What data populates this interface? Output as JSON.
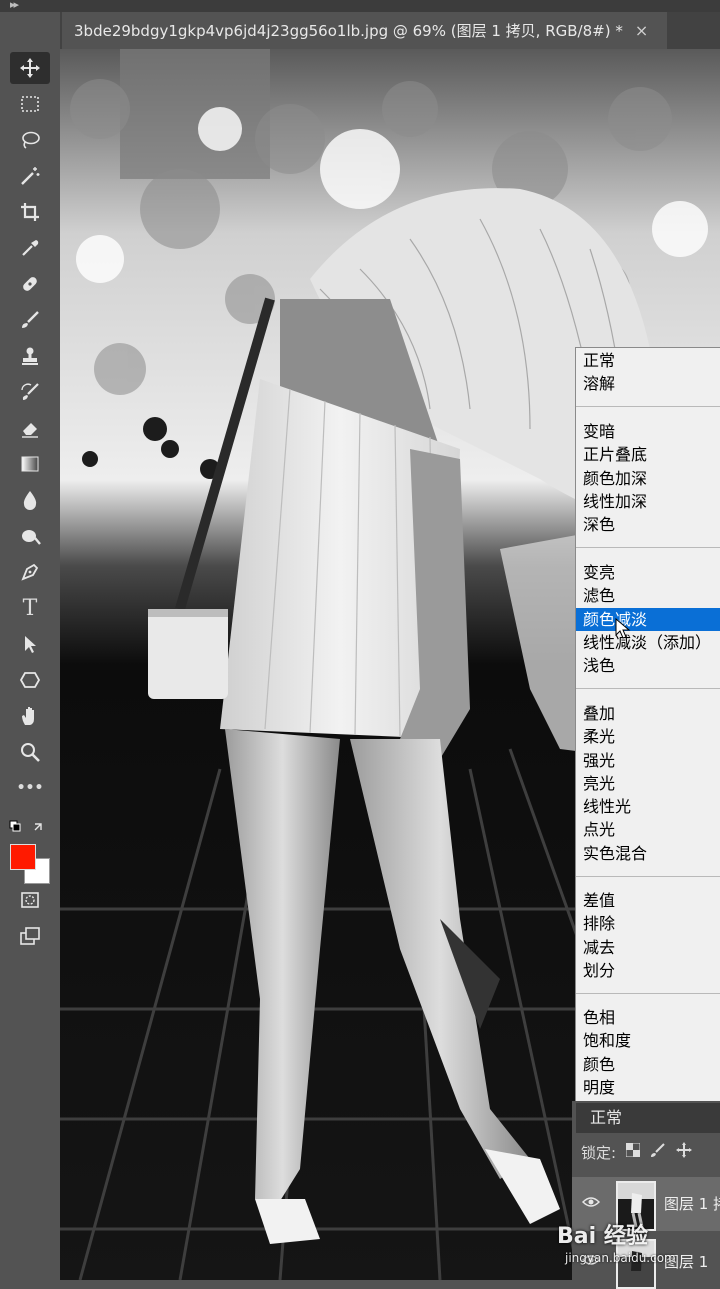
{
  "document": {
    "tab_title": "3bde29bdgy1gkp4vp6jd4j23gg56o1lb.jpg @ 69% (图层 1 拷贝, RGB/8#) *",
    "tab_close": "×"
  },
  "toolbar": {
    "collapse_glyph": "▸▸",
    "tools": [
      {
        "name": "move-tool-icon",
        "active": true
      },
      {
        "name": "marquee-tool-icon"
      },
      {
        "name": "lasso-tool-icon"
      },
      {
        "name": "magic-wand-tool-icon"
      },
      {
        "name": "crop-tool-icon"
      },
      {
        "name": "eyedropper-tool-icon"
      },
      {
        "name": "healing-brush-tool-icon"
      },
      {
        "name": "brush-tool-icon"
      },
      {
        "name": "clone-stamp-tool-icon"
      },
      {
        "name": "history-brush-tool-icon"
      },
      {
        "name": "eraser-tool-icon"
      },
      {
        "name": "gradient-tool-icon"
      },
      {
        "name": "blur-tool-icon"
      },
      {
        "name": "dodge-tool-icon"
      },
      {
        "name": "pen-tool-icon"
      },
      {
        "name": "type-tool-icon",
        "label": "T"
      },
      {
        "name": "path-selection-tool-icon"
      },
      {
        "name": "shape-tool-icon"
      },
      {
        "name": "hand-tool-icon"
      },
      {
        "name": "zoom-tool-icon"
      },
      {
        "name": "more-tools-icon",
        "label": "•••"
      }
    ],
    "foreground_color": "#ff1a00",
    "background_color": "#ffffff"
  },
  "blend_menu": {
    "groups": [
      [
        "正常",
        "溶解"
      ],
      [
        "变暗",
        "正片叠底",
        "颜色加深",
        "线性加深",
        "深色"
      ],
      [
        "变亮",
        "滤色",
        "颜色减淡",
        "线性减淡（添加）",
        "浅色"
      ],
      [
        "叠加",
        "柔光",
        "强光",
        "亮光",
        "线性光",
        "点光",
        "实色混合"
      ],
      [
        "差值",
        "排除",
        "减去",
        "划分"
      ],
      [
        "色相",
        "饱和度",
        "颜色",
        "明度"
      ]
    ],
    "highlighted": "颜色减淡",
    "highlight_color": "#0a6fd6"
  },
  "layers_panel": {
    "blend_mode_value": "正常",
    "lock_label": "锁定:",
    "layers": [
      {
        "name": "图层 1 拷",
        "selected": true
      },
      {
        "name": "图层 1",
        "selected": false
      }
    ]
  },
  "watermark": {
    "main": "Bai 经验",
    "sub": "jingyan.baidu.com"
  }
}
